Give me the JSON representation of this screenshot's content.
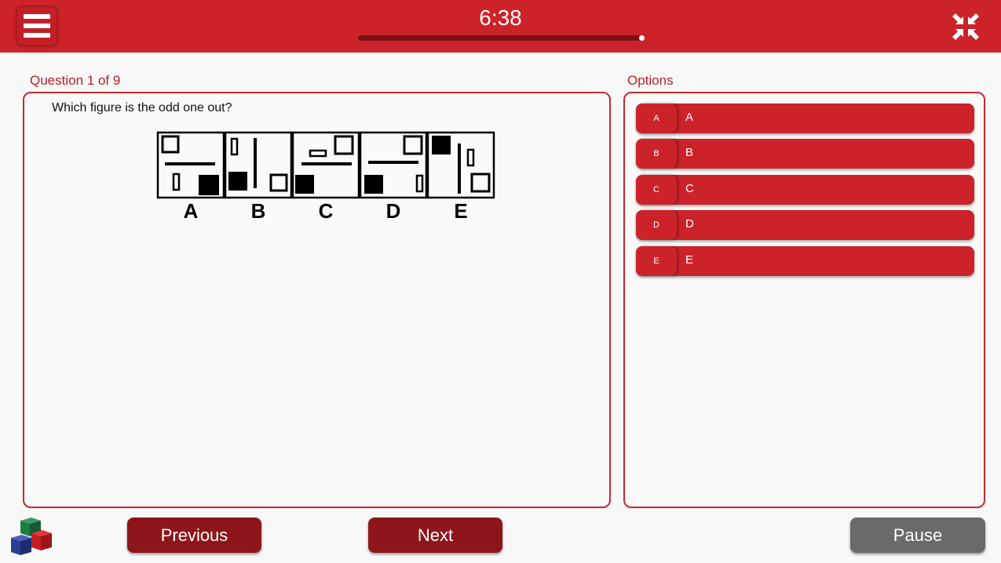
{
  "header": {
    "timer": "6:38",
    "timer_progress": 1.0
  },
  "question": {
    "counter": "Question 1 of 9",
    "text": "Which figure is the odd one out?",
    "figure_labels": [
      "A",
      "B",
      "C",
      "D",
      "E"
    ]
  },
  "options": {
    "title": "Options",
    "items": [
      {
        "key": "A",
        "label": "A"
      },
      {
        "key": "B",
        "label": "B"
      },
      {
        "key": "C",
        "label": "C"
      },
      {
        "key": "D",
        "label": "D"
      },
      {
        "key": "E",
        "label": "E"
      }
    ]
  },
  "nav": {
    "previous": "Previous",
    "next": "Next",
    "pause": "Pause"
  },
  "colors": {
    "primary": "#cc2229",
    "dark_button": "#8e161a",
    "pause_button": "#6a6a6a"
  },
  "icons": [
    "menu-icon",
    "collapse-icon",
    "cubes-logo"
  ]
}
